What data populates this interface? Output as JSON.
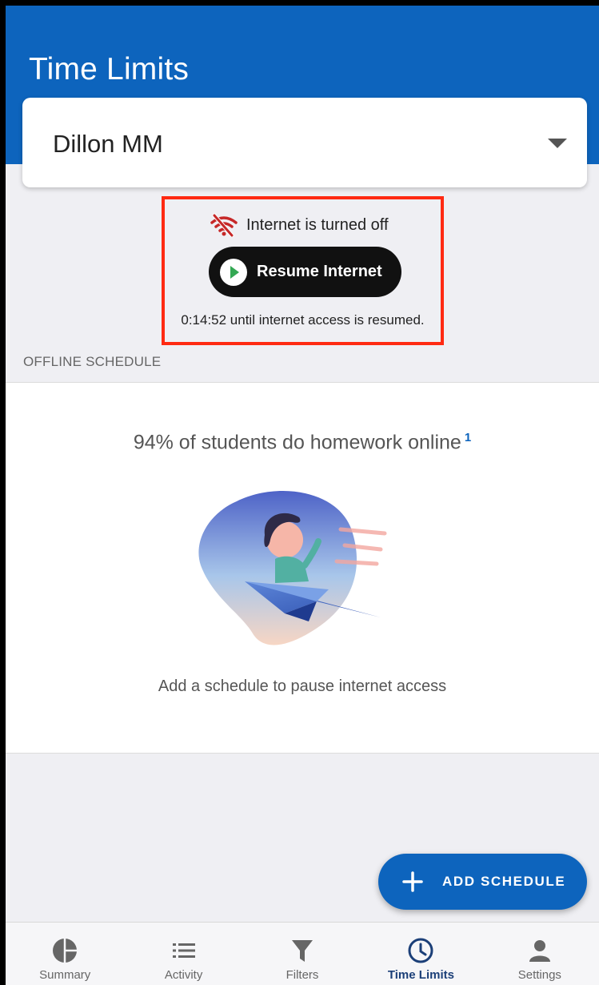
{
  "header": {
    "title": "Time Limits"
  },
  "profile_selector": {
    "value": "Dillon MM",
    "caret_icon": "dropdown-caret-icon"
  },
  "status": {
    "icon": "wifi-off-icon",
    "text": "Internet is turned off",
    "resume_button_label": "Resume Internet",
    "countdown": "0:14:52 until internet access is resumed."
  },
  "section": {
    "label": "OFFLINE SCHEDULE"
  },
  "promo": {
    "headline": "94% of students do homework online",
    "footnote": "1",
    "caption": "Add a schedule to pause internet access"
  },
  "fab": {
    "label": "ADD SCHEDULE",
    "icon": "plus-icon"
  },
  "nav": {
    "items": [
      {
        "label": "Summary",
        "icon": "pie-chart-icon",
        "active": false
      },
      {
        "label": "Activity",
        "icon": "list-icon",
        "active": false
      },
      {
        "label": "Filters",
        "icon": "filter-icon",
        "active": false
      },
      {
        "label": "Time Limits",
        "icon": "clock-icon",
        "active": true
      },
      {
        "label": "Settings",
        "icon": "person-icon",
        "active": false
      }
    ]
  },
  "colors": {
    "header_blue": "#0d64bd",
    "highlight_border": "#ff2a12",
    "wifi_off_red": "#c62828",
    "play_green": "#33a853",
    "active_nav": "#1b3f78"
  }
}
